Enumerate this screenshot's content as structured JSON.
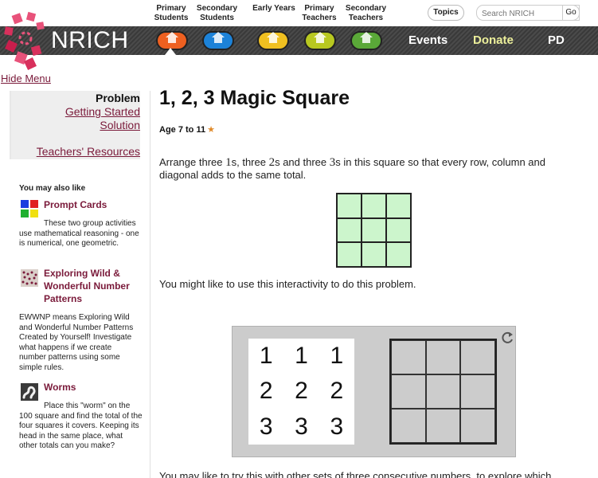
{
  "header": {
    "audience_links": [
      {
        "line1": "Primary",
        "line2": "Students"
      },
      {
        "line1": "Secondary",
        "line2": "Students"
      },
      {
        "line1": "Early Years",
        "line2": ""
      },
      {
        "line1": "Primary",
        "line2": "Teachers"
      },
      {
        "line1": "Secondary",
        "line2": "Teachers"
      }
    ],
    "topics_label": "Topics",
    "search_placeholder": "Search NRICH",
    "go_label": "Go",
    "brand": "NRICH",
    "stage_colors": [
      "#ee6020",
      "#1c82d8",
      "#f0c020",
      "#b8c820",
      "#5aa838"
    ],
    "nav": {
      "events": "Events",
      "donate": "Donate",
      "pd": "PD"
    }
  },
  "sidebar": {
    "hide_menu": "Hide Menu",
    "problem_nav": {
      "problem": "Problem",
      "getting_started": "Getting Started",
      "solution": "Solution",
      "teachers_resources": "Teachers' Resources"
    },
    "also_like_heading": "You may also like",
    "related": [
      {
        "icon": "prompt-cards-icon",
        "title": "Prompt Cards",
        "desc": "These two group activities use mathematical reasoning - one is numerical, one geometric."
      },
      {
        "icon": "number-patterns-icon",
        "title": "Exploring Wild & Wonderful Number Patterns",
        "desc": "EWWNP means Exploring Wild and Wonderful Number Patterns Created by Yourself! Investigate what happens if we create number patterns using some simple rules."
      },
      {
        "icon": "worm-icon",
        "title": "Worms",
        "desc": "Place this \"worm\" on the 100 square and find the total of the four squares it covers. Keeping its head in the same place, what other totals can you make?"
      }
    ]
  },
  "main": {
    "title": "1, 2, 3 Magic Square",
    "age_label": "Age 7 to 11",
    "star": "★",
    "intro": {
      "p1": "Arrange three ",
      "n1": "1",
      "p2": "s, three ",
      "n2": "2",
      "p3": "s and three ",
      "n3": "3",
      "p4": "s in this square so that every row, column and diagonal adds to the same total."
    },
    "interactivity_text": "You might like to use this interactivity to do this problem.",
    "tiles": [
      "1",
      "1",
      "1",
      "2",
      "2",
      "2",
      "3",
      "3",
      "3"
    ],
    "bottom_text": "You may like to try this with other sets of three consecutive numbers, to explore which"
  },
  "colors": {
    "link": "#7a1a3a",
    "square_fill": "#ccf5cc",
    "panel_bg": "#cccccc"
  }
}
